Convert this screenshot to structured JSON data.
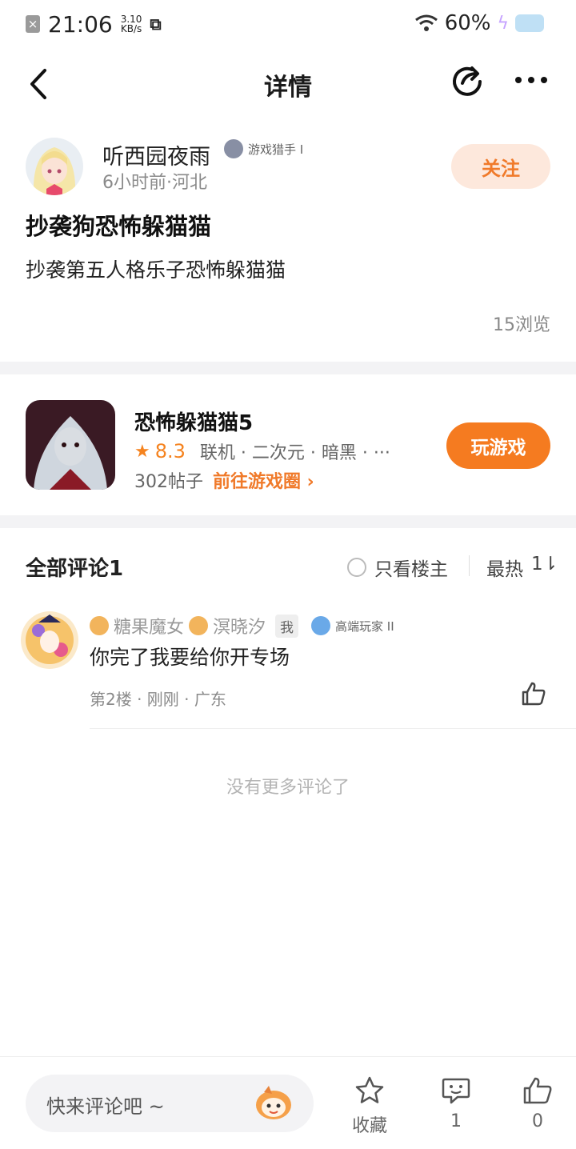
{
  "status_bar": {
    "time": "21:06",
    "speed_value": "3.10",
    "speed_unit": "KB/s",
    "battery": "60%"
  },
  "nav": {
    "title": "详情"
  },
  "post": {
    "author": "听西园夜雨",
    "author_badge": "游戏猎手 I",
    "meta": "6小时前·河北",
    "follow_label": "关注",
    "title": "抄袭狗恐怖躲猫猫",
    "body": "抄袭第五人格乐子恐怖躲猫猫",
    "views": "15浏览"
  },
  "game": {
    "name": "恐怖躲猫猫5",
    "score": "8.3",
    "tags": "联机 · 二次元 · 暗黑 · ···",
    "posts": "302帖子",
    "goto_label": "前往游戏圈 ›",
    "play_label": "玩游戏",
    "accent": "#f57b20"
  },
  "comments": {
    "title": "全部评论1",
    "only_owner_label": "只看楼主",
    "sort_label": "最热",
    "sort_icon_text": "1⇂",
    "items": [
      {
        "name_part1": "糖果魔女",
        "name_part2": "溟晓汐",
        "me_tag": "我",
        "badge": "高端玩家 II",
        "text": "你完了我要给你开专场",
        "meta": "第2楼 · 刚刚 · 广东"
      }
    ],
    "no_more": "没有更多评论了"
  },
  "bottom_bar": {
    "input_placeholder": "快来评论吧 ~",
    "favorite_label": "收藏",
    "comment_count": "1",
    "like_count": "0"
  }
}
